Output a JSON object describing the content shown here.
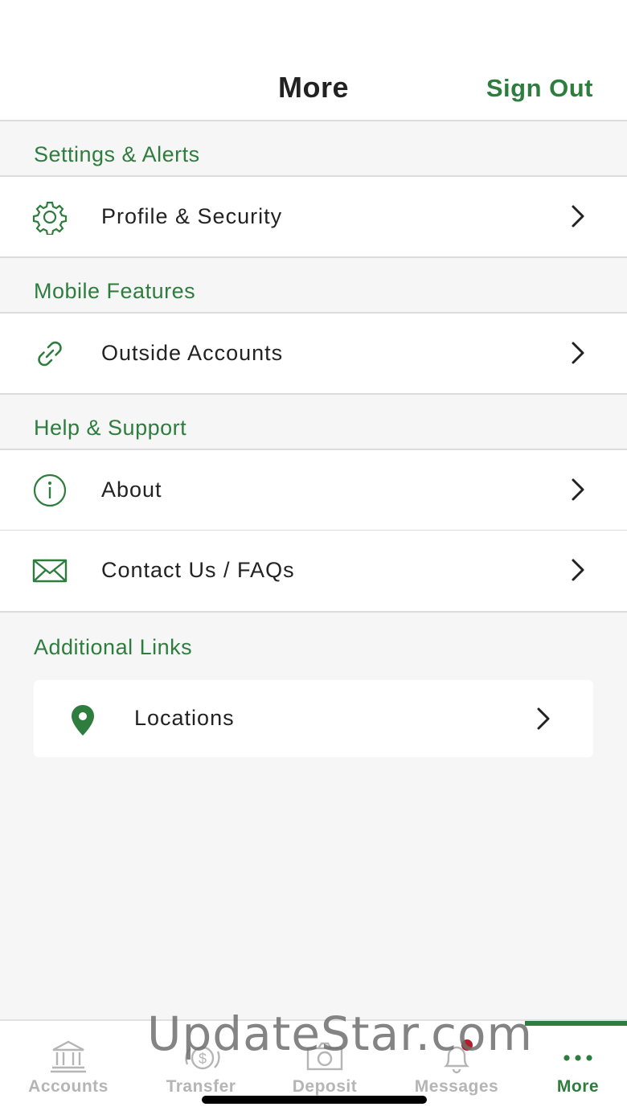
{
  "header": {
    "title": "More",
    "sign_out": "Sign Out"
  },
  "sections": {
    "settings": "Settings & Alerts",
    "mobile": "Mobile Features",
    "help": "Help & Support",
    "links": "Additional Links"
  },
  "rows": {
    "profile": {
      "label": "Profile & Security",
      "icon": "gear-icon"
    },
    "outside": {
      "label": "Outside Accounts",
      "icon": "link-icon"
    },
    "about": {
      "label": "About",
      "icon": "info-icon"
    },
    "contact": {
      "label": "Contact Us / FAQs",
      "icon": "envelope-icon"
    },
    "locations": {
      "label": "Locations",
      "icon": "map-pin-icon"
    }
  },
  "tabbar": {
    "tabs": [
      {
        "label": "Accounts",
        "icon": "bank-icon",
        "active": false
      },
      {
        "label": "Transfer",
        "icon": "transfer-dollar-icon",
        "active": false
      },
      {
        "label": "Deposit",
        "icon": "camera-icon",
        "active": false
      },
      {
        "label": "Messages",
        "icon": "bell-icon",
        "active": false,
        "badge": true
      },
      {
        "label": "More",
        "icon": "more-dots-icon",
        "active": true
      }
    ]
  },
  "watermark": "UpdateStar.com",
  "colors": {
    "accent": "#2e7d3e",
    "inactive": "#b5b5b5",
    "badge": "#b01e2a",
    "background": "#f6f6f6"
  }
}
